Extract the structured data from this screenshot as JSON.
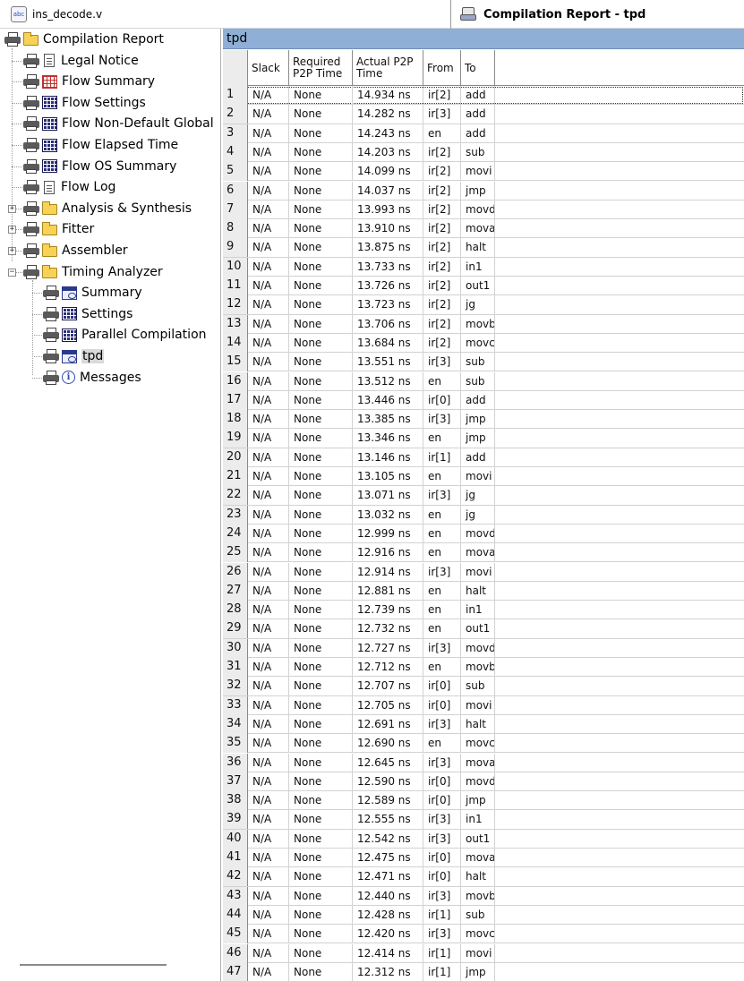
{
  "tabs": {
    "file_tab": {
      "label": "ins_decode.v",
      "icon_text": "abc"
    },
    "report_tab": {
      "label": "Compilation Report - tpd"
    }
  },
  "tree": {
    "root": "Compilation Report",
    "items": [
      {
        "label": "Legal Notice",
        "icon": "doc-icon"
      },
      {
        "label": "Flow Summary",
        "icon": "table-red-icon"
      },
      {
        "label": "Flow Settings",
        "icon": "table-icon"
      },
      {
        "label": "Flow Non-Default Global",
        "icon": "table-icon"
      },
      {
        "label": "Flow Elapsed Time",
        "icon": "table-icon"
      },
      {
        "label": "Flow OS Summary",
        "icon": "table-icon"
      },
      {
        "label": "Flow Log",
        "icon": "doc-icon"
      },
      {
        "label": "Analysis & Synthesis",
        "icon": "folder-icon"
      },
      {
        "label": "Fitter",
        "icon": "folder-icon"
      },
      {
        "label": "Assembler",
        "icon": "folder-icon"
      },
      {
        "label": "Timing Analyzer",
        "icon": "folder-icon"
      },
      {
        "label": "Summary",
        "icon": "chart-icon"
      },
      {
        "label": "Settings",
        "icon": "table-icon"
      },
      {
        "label": "Parallel Compilation",
        "icon": "table-icon"
      },
      {
        "label": "tpd",
        "icon": "chart-icon"
      },
      {
        "label": "Messages",
        "icon": "info-icon"
      }
    ]
  },
  "grid": {
    "title": "tpd",
    "headers": {
      "slack": "Slack",
      "required": "Required\nP2P Time",
      "actual": "Actual P2P\nTime",
      "from": "From",
      "to": "To"
    },
    "rows": [
      [
        "1",
        "N/A",
        "None",
        "14.934 ns",
        "ir[2]",
        "add"
      ],
      [
        "2",
        "N/A",
        "None",
        "14.282 ns",
        "ir[3]",
        "add"
      ],
      [
        "3",
        "N/A",
        "None",
        "14.243 ns",
        "en",
        "add"
      ],
      [
        "4",
        "N/A",
        "None",
        "14.203 ns",
        "ir[2]",
        "sub"
      ],
      [
        "5",
        "N/A",
        "None",
        "14.099 ns",
        "ir[2]",
        "movi"
      ],
      [
        "6",
        "N/A",
        "None",
        "14.037 ns",
        "ir[2]",
        "jmp"
      ],
      [
        "7",
        "N/A",
        "None",
        "13.993 ns",
        "ir[2]",
        "movd"
      ],
      [
        "8",
        "N/A",
        "None",
        "13.910 ns",
        "ir[2]",
        "mova"
      ],
      [
        "9",
        "N/A",
        "None",
        "13.875 ns",
        "ir[2]",
        "halt"
      ],
      [
        "10",
        "N/A",
        "None",
        "13.733 ns",
        "ir[2]",
        "in1"
      ],
      [
        "11",
        "N/A",
        "None",
        "13.726 ns",
        "ir[2]",
        "out1"
      ],
      [
        "12",
        "N/A",
        "None",
        "13.723 ns",
        "ir[2]",
        "jg"
      ],
      [
        "13",
        "N/A",
        "None",
        "13.706 ns",
        "ir[2]",
        "movb"
      ],
      [
        "14",
        "N/A",
        "None",
        "13.684 ns",
        "ir[2]",
        "movc"
      ],
      [
        "15",
        "N/A",
        "None",
        "13.551 ns",
        "ir[3]",
        "sub"
      ],
      [
        "16",
        "N/A",
        "None",
        "13.512 ns",
        "en",
        "sub"
      ],
      [
        "17",
        "N/A",
        "None",
        "13.446 ns",
        "ir[0]",
        "add"
      ],
      [
        "18",
        "N/A",
        "None",
        "13.385 ns",
        "ir[3]",
        "jmp"
      ],
      [
        "19",
        "N/A",
        "None",
        "13.346 ns",
        "en",
        "jmp"
      ],
      [
        "20",
        "N/A",
        "None",
        "13.146 ns",
        "ir[1]",
        "add"
      ],
      [
        "21",
        "N/A",
        "None",
        "13.105 ns",
        "en",
        "movi"
      ],
      [
        "22",
        "N/A",
        "None",
        "13.071 ns",
        "ir[3]",
        "jg"
      ],
      [
        "23",
        "N/A",
        "None",
        "13.032 ns",
        "en",
        "jg"
      ],
      [
        "24",
        "N/A",
        "None",
        "12.999 ns",
        "en",
        "movd"
      ],
      [
        "25",
        "N/A",
        "None",
        "12.916 ns",
        "en",
        "mova"
      ],
      [
        "26",
        "N/A",
        "None",
        "12.914 ns",
        "ir[3]",
        "movi"
      ],
      [
        "27",
        "N/A",
        "None",
        "12.881 ns",
        "en",
        "halt"
      ],
      [
        "28",
        "N/A",
        "None",
        "12.739 ns",
        "en",
        "in1"
      ],
      [
        "29",
        "N/A",
        "None",
        "12.732 ns",
        "en",
        "out1"
      ],
      [
        "30",
        "N/A",
        "None",
        "12.727 ns",
        "ir[3]",
        "movd"
      ],
      [
        "31",
        "N/A",
        "None",
        "12.712 ns",
        "en",
        "movb"
      ],
      [
        "32",
        "N/A",
        "None",
        "12.707 ns",
        "ir[0]",
        "sub"
      ],
      [
        "33",
        "N/A",
        "None",
        "12.705 ns",
        "ir[0]",
        "movi"
      ],
      [
        "34",
        "N/A",
        "None",
        "12.691 ns",
        "ir[3]",
        "halt"
      ],
      [
        "35",
        "N/A",
        "None",
        "12.690 ns",
        "en",
        "movc"
      ],
      [
        "36",
        "N/A",
        "None",
        "12.645 ns",
        "ir[3]",
        "mova"
      ],
      [
        "37",
        "N/A",
        "None",
        "12.590 ns",
        "ir[0]",
        "movd"
      ],
      [
        "38",
        "N/A",
        "None",
        "12.589 ns",
        "ir[0]",
        "jmp"
      ],
      [
        "39",
        "N/A",
        "None",
        "12.555 ns",
        "ir[3]",
        "in1"
      ],
      [
        "40",
        "N/A",
        "None",
        "12.542 ns",
        "ir[3]",
        "out1"
      ],
      [
        "41",
        "N/A",
        "None",
        "12.475 ns",
        "ir[0]",
        "mova"
      ],
      [
        "42",
        "N/A",
        "None",
        "12.471 ns",
        "ir[0]",
        "halt"
      ],
      [
        "43",
        "N/A",
        "None",
        "12.440 ns",
        "ir[3]",
        "movb"
      ],
      [
        "44",
        "N/A",
        "None",
        "12.428 ns",
        "ir[1]",
        "sub"
      ],
      [
        "45",
        "N/A",
        "None",
        "12.420 ns",
        "ir[3]",
        "movc"
      ],
      [
        "46",
        "N/A",
        "None",
        "12.414 ns",
        "ir[1]",
        "movi"
      ],
      [
        "47",
        "N/A",
        "None",
        "12.312 ns",
        "ir[1]",
        "jmp"
      ]
    ]
  },
  "colors": {
    "grid_title_bg": "#8fafd6",
    "header_bg": "#ececec",
    "selected_bg": "#d9d9d9"
  }
}
